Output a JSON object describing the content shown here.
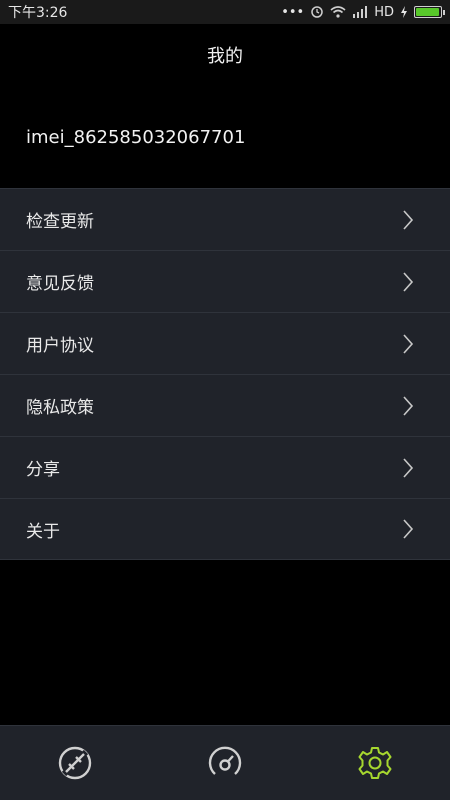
{
  "status_bar": {
    "time": "下午3:26",
    "network": "HD",
    "battery_level": 0.95,
    "battery_color": "#58c82a"
  },
  "header": {
    "title": "我的"
  },
  "profile": {
    "imei": "imei_862585032067701"
  },
  "menu": {
    "items": [
      {
        "label": "检查更新",
        "icon": "chevron-right-icon"
      },
      {
        "label": "意见反馈",
        "icon": "chevron-right-icon"
      },
      {
        "label": "用户协议",
        "icon": "chevron-right-icon"
      },
      {
        "label": "隐私政策",
        "icon": "chevron-right-icon"
      },
      {
        "label": "分享",
        "icon": "chevron-right-icon"
      },
      {
        "label": "关于",
        "icon": "chevron-right-icon"
      }
    ]
  },
  "tabbar": {
    "tabs": [
      {
        "icon": "disconnect-link-icon",
        "active": false
      },
      {
        "icon": "speedometer-icon",
        "active": false
      },
      {
        "icon": "settings-gear-icon",
        "active": true
      }
    ],
    "active_color": "#a6d72f",
    "inactive_color": "#d0d0d0"
  }
}
